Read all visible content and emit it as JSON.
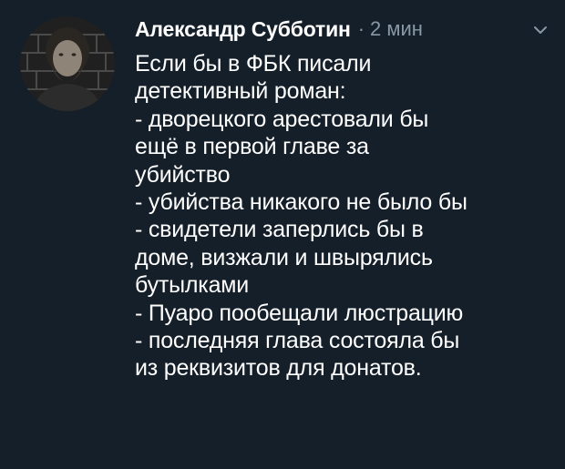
{
  "tweet": {
    "author_name": "Александр Субботин",
    "separator": "·",
    "time": "2 мин",
    "lines": [
      "Если бы в ФБК писали",
      "детективный роман:",
      "- дворецкого арестовали бы",
      "ещё в первой главе за",
      "убийство",
      "- убийства никакого не было бы",
      "- свидетели заперлись бы в",
      "доме, визжали и швырялись",
      "бутылками",
      "- Пуаро пообещали люстрацию",
      "- последняя глава состояла бы",
      "из реквизитов для донатов."
    ]
  },
  "colors": {
    "background": "#151f2a",
    "text": "#ffffff",
    "muted": "#8899a6"
  },
  "icons": {
    "avatar": "user-avatar-photo",
    "menu": "chevron-down-icon"
  }
}
